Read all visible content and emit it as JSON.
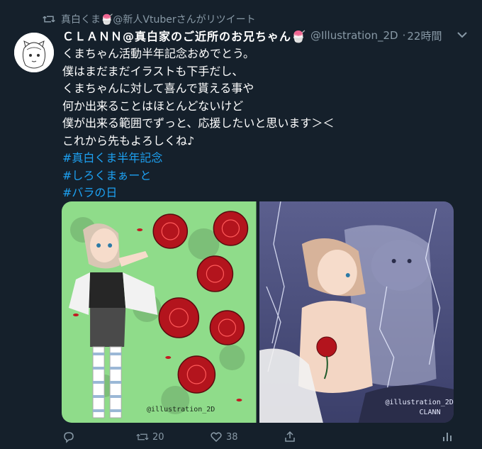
{
  "retweet_banner": {
    "text": "真白くま🍧@新人Vtuberさんがリツイート",
    "icon": "retweet-icon"
  },
  "tweet": {
    "display_name": "ＣＬＡＮＮ@真白家のご近所のお兄ちゃん🍧",
    "handle": "@Illustration_2D",
    "time": "22時間",
    "lines": [
      "くまちゃん活動半年記念おめでとう。",
      "僕はまだまだイラストも下手だし、",
      "くまちゃんに対して喜んで貰える事や",
      "何か出来ることはほとんどないけど",
      "僕が出来る範囲でずっと、応援したいと思います＞＜",
      "これから先もよろしくね♪"
    ],
    "hashtags": [
      "#真白くま半年記念",
      "#しろくまぁーと",
      "#バラの日"
    ]
  },
  "media": {
    "left_watermark": "@illustration_2D",
    "right_watermark": "@illustration_2D",
    "right_signature": "CLANN"
  },
  "actions": {
    "reply_count": "",
    "retweet_count": "20",
    "like_count": "38"
  },
  "colors": {
    "background": "#15202b",
    "secondary": "#8899a6",
    "accent": "#1da1f2"
  }
}
